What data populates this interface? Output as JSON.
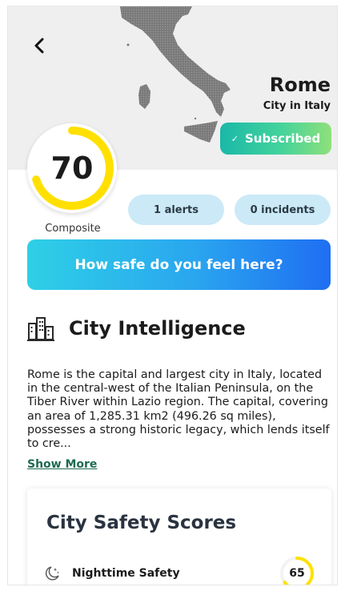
{
  "header": {
    "city_name": "Rome",
    "city_subtitle": "City in Italy",
    "subscribed_label": "Subscribed"
  },
  "composite": {
    "score": "70",
    "score_fraction": 0.7,
    "label": "Composite"
  },
  "badges": {
    "alerts": "1 alerts",
    "incidents": "0 incidents"
  },
  "cta": {
    "label": "How safe do you feel here?"
  },
  "intelligence": {
    "title": "City Intelligence",
    "text": "Rome is the capital and largest city in Italy, located in the central-west of the Italian Peninsula, on the Tiber River within Lazio region. The capital, covering an area of 1,285.31 km2 (496.26 sq miles), possesses a strong historic legacy, which lends itself to cre...",
    "show_more": "Show More"
  },
  "safety_scores": {
    "title": "City Safety Scores",
    "items": [
      {
        "label": "Nighttime Safety",
        "score": "65",
        "score_fraction": 0.65
      }
    ]
  },
  "colors": {
    "score_ring": "#ffe000",
    "subscribed_gradient_start": "#1ab8a8",
    "subscribed_gradient_end": "#8fe07a",
    "cta_gradient_start": "#2ed0e6",
    "cta_gradient_end": "#1f6ef2",
    "pill_bg": "#cbe9f7",
    "link": "#1e6b4f"
  },
  "icons": {
    "back": "chevron-left-icon",
    "check": "check-icon",
    "intelligence": "city-buildings-icon",
    "nighttime": "moon-stars-icon"
  }
}
